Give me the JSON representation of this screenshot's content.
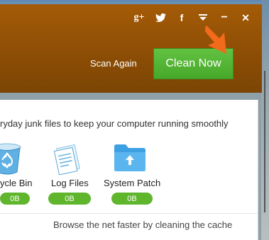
{
  "topbar": {
    "icons": [
      "google-plus-icon",
      "twitter-icon",
      "facebook-icon",
      "menu-icon",
      "minimize-icon",
      "close-icon"
    ],
    "gplus_glyph": "g+",
    "facebook_glyph": "f",
    "minimize_glyph": "−",
    "close_glyph": "✕"
  },
  "header": {
    "scan_again_label": "Scan Again",
    "clean_now_label": "Clean Now"
  },
  "panel": {
    "description": "ryday junk files to keep your computer running smoothly",
    "items": [
      {
        "label": "ycle Bin",
        "size": "0B"
      },
      {
        "label": "Log Files",
        "size": "0B"
      },
      {
        "label": "System Patch",
        "size": "0B"
      }
    ],
    "footer_text": "Browse the net faster by cleaning the cache"
  },
  "colors": {
    "header": "#9a5406",
    "accent_green": "#4caf2e",
    "badge_green": "#5fb52c",
    "arrow_orange": "#f26a1b"
  }
}
